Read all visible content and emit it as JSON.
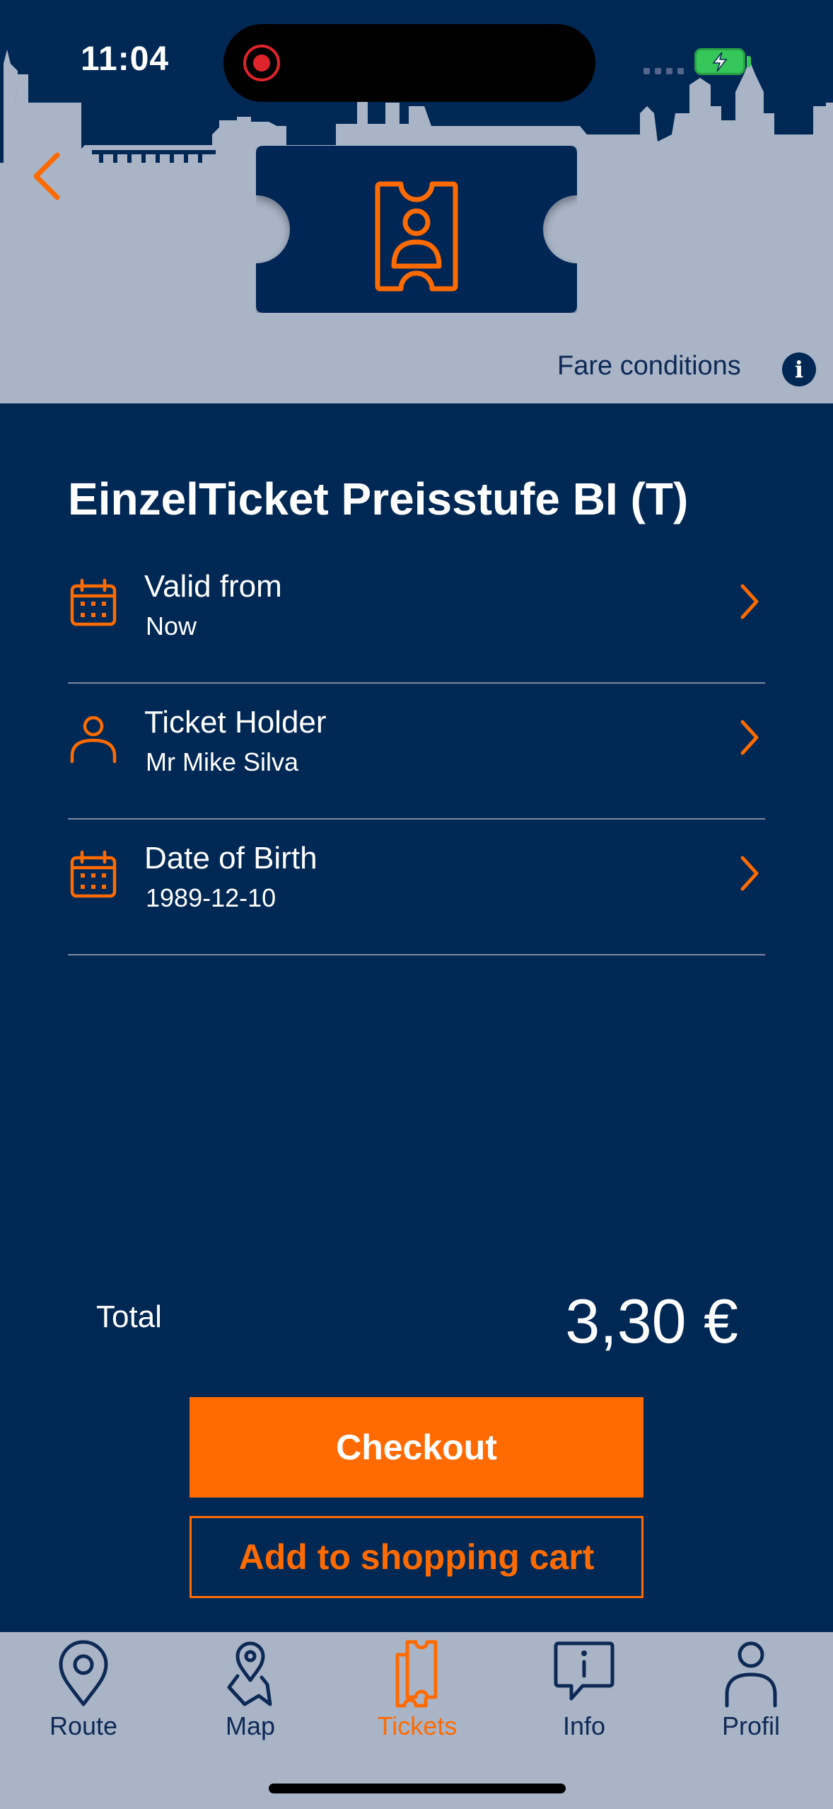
{
  "status_bar": {
    "time": "11:04"
  },
  "header": {
    "fare_conditions": "Fare conditions",
    "info_glyph": "i",
    "back_icon": "chevron-left-icon",
    "ticket_icon": "person-ticket-icon"
  },
  "ticket": {
    "title": "EinzelTicket Preisstufe BI (T)",
    "rows": [
      {
        "label": "Valid from",
        "value": "Now",
        "icon": "calendar-icon"
      },
      {
        "label": "Ticket Holder",
        "value": "Mr Mike Silva",
        "icon": "person-icon"
      },
      {
        "label": "Date of Birth",
        "value": "1989-12-10",
        "icon": "calendar-icon"
      }
    ]
  },
  "summary": {
    "total_label": "Total",
    "total_value": "3,30 €"
  },
  "actions": {
    "checkout": "Checkout",
    "add_to_cart": "Add to shopping cart"
  },
  "tabs": [
    {
      "label": "Route",
      "icon": "location-pin-icon",
      "active": false
    },
    {
      "label": "Map",
      "icon": "map-pin-icon",
      "active": false
    },
    {
      "label": "Tickets",
      "icon": "tickets-icon",
      "active": true
    },
    {
      "label": "Info",
      "icon": "info-bubble-icon",
      "active": false
    },
    {
      "label": "Profil",
      "icon": "person-icon",
      "active": false
    }
  ],
  "colors": {
    "accent": "#ff6b00",
    "primary": "#002855",
    "header_bg": "#a9b4c7"
  }
}
